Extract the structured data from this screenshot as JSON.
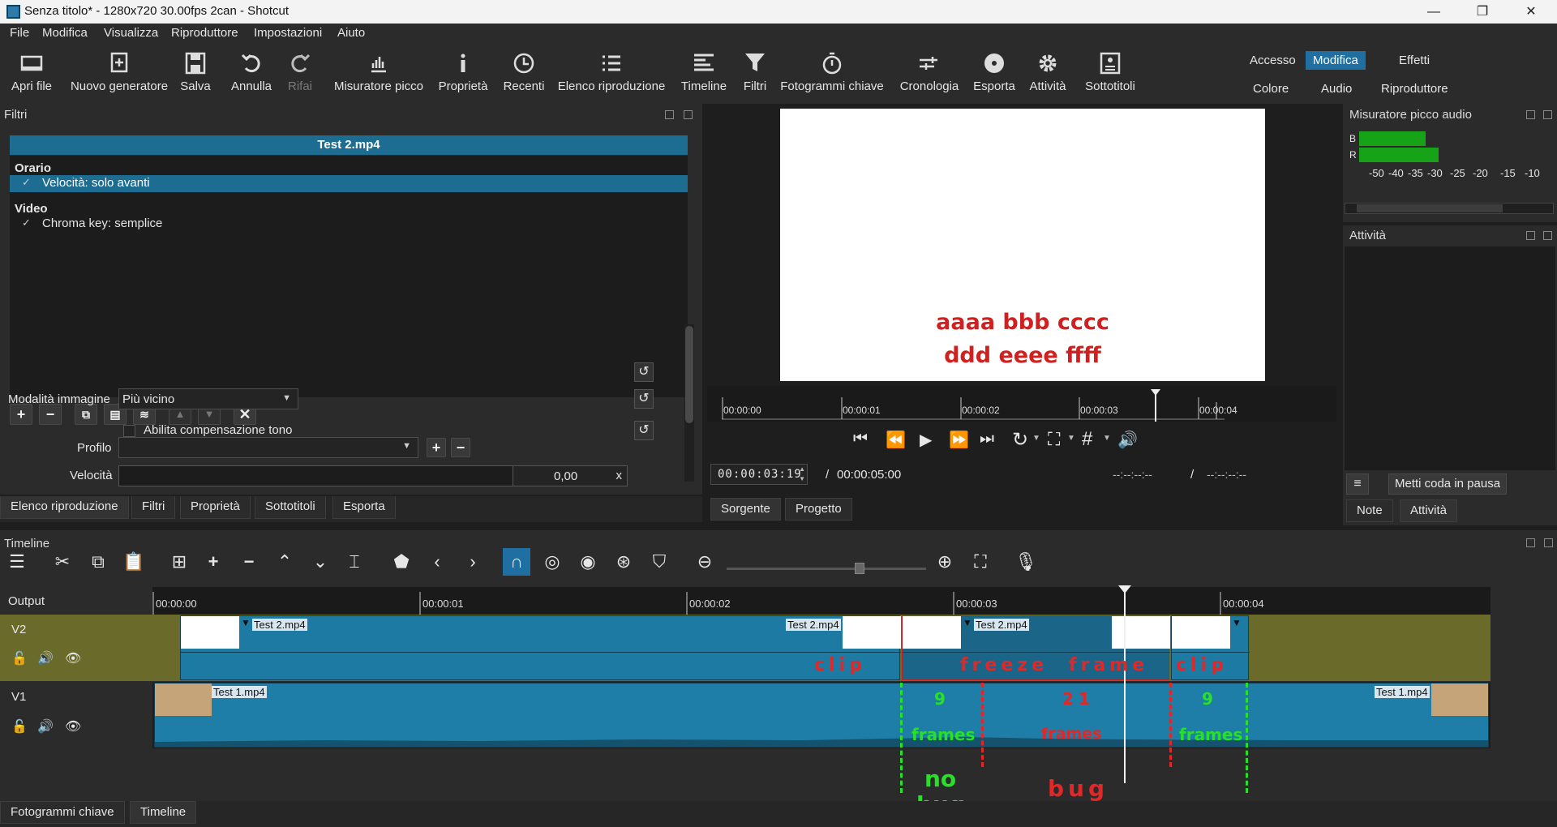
{
  "window": {
    "title": "Senza titolo* - 1280x720 30.00fps 2can - Shotcut",
    "min": "—",
    "max": "❐",
    "close": "✕"
  },
  "menu": [
    "File",
    "Modifica",
    "Visualizza",
    "Riproduttore",
    "Impostazioni",
    "Aiuto"
  ],
  "toolbar": {
    "open": "Apri file",
    "generator": "Nuovo generatore",
    "save": "Salva",
    "undo": "Annulla",
    "redo": "Rifai",
    "peak": "Misuratore picco",
    "properties": "Proprietà",
    "recent": "Recenti",
    "playlist": "Elenco riproduzione",
    "timeline": "Timeline",
    "filters": "Filtri",
    "keyframes": "Fotogrammi chiave",
    "history": "Cronologia",
    "export": "Esporta",
    "jobs": "Attività",
    "subtitles": "Sottotitoli"
  },
  "workspaces": {
    "access": "Accesso",
    "edit": "Modifica",
    "effects": "Effetti",
    "color": "Colore",
    "audio": "Audio",
    "player": "Riproduttore"
  },
  "filters_panel": {
    "title": "Filtri",
    "clip_name": "Test 2.mp4",
    "group_time": "Orario",
    "filter_speed": "Velocità: solo avanti",
    "group_video": "Video",
    "filter_chroma": "Chroma key: semplice",
    "check": "✓",
    "profile_label": "Profilo",
    "speed_label": "Velocità",
    "speed_value": "0,00",
    "speed_clear": "x",
    "image_mode_label": "Modalità immagine",
    "image_mode_value": "Più vicino",
    "pitch_label": "Abilita compensazione tono"
  },
  "left_tabs": [
    "Elenco riproduzione",
    "Filtri",
    "Proprietà",
    "Sottotitoli",
    "Esporta"
  ],
  "player": {
    "overlay_line1": "aaaa bbb cccc",
    "overlay_line2": "ddd eeee ffff",
    "ruler": [
      "00:00:00",
      "00:00:01",
      "00:00:02",
      "00:00:03",
      "00:00:04"
    ],
    "position": "00:00:03:19",
    "sep": "/",
    "duration": "00:00:05:00",
    "in_point": "--:--:--:--",
    "out_point": "--:--:--:--",
    "tab_source": "Sorgente",
    "tab_project": "Progetto"
  },
  "audio_meter": {
    "title": "Misuratore picco audio",
    "left": "B",
    "right": "R",
    "scale": [
      "-50",
      "-40",
      "-35",
      "-30",
      "-25",
      "-20",
      "-15",
      "-10"
    ],
    "level_left": 0.35,
    "level_right": 0.42
  },
  "jobs_panel": {
    "title": "Attività",
    "menu": "≡",
    "pause": "Metti coda in pausa",
    "tab_notes": "Note",
    "tab_jobs": "Attività"
  },
  "timeline": {
    "title": "Timeline",
    "output": "Output",
    "ruler": [
      "00:00:00",
      "00:00:01",
      "00:00:02",
      "00:00:03",
      "00:00:04"
    ],
    "v2": "V2",
    "v1": "V1",
    "clip_v2": "Test 2.mp4",
    "clip_v1": "Test 1.mp4"
  },
  "annotations": {
    "clip_left": "clip",
    "freeze": "freeze",
    "frame": "frame",
    "clip_right": "clip",
    "n9a": "9",
    "n21": "21",
    "n9b": "9",
    "frames_a": "frames",
    "frames_b": "frames",
    "frames_c": "frames",
    "no": "no",
    "bug_green": "bug",
    "bug_red": "bug"
  },
  "bottom_tabs": [
    "Fotogrammi chiave",
    "Timeline"
  ],
  "colors": {
    "accent": "#1f6fa3",
    "v2_track": "#6a6a2a",
    "clip": "#1d7aa3",
    "annot_red": "#e02828",
    "annot_green": "#28e028"
  }
}
